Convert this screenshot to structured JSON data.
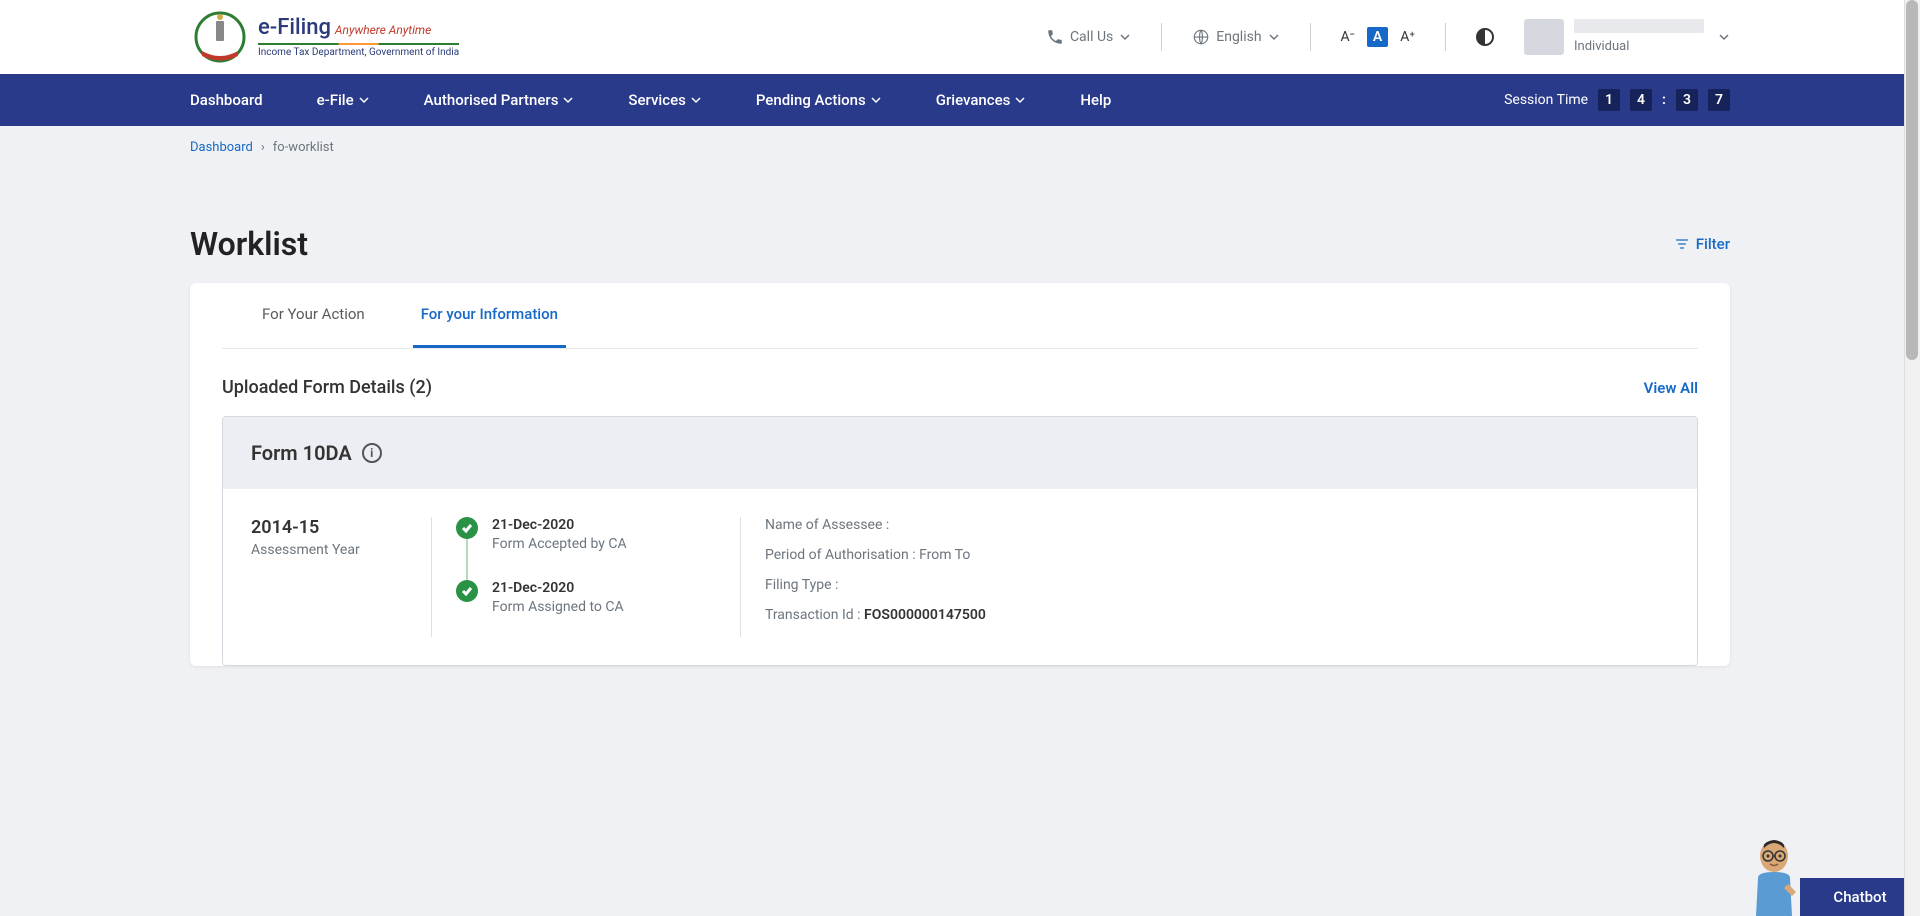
{
  "header": {
    "logo_main": "e-Filing",
    "logo_tagline": "Anywhere Anytime",
    "logo_sub": "Income Tax Department, Government of India",
    "call_us": "Call Us",
    "language": "English",
    "font_small": "A⁻",
    "font_normal": "A",
    "font_large": "A⁺",
    "user_type": "Individual"
  },
  "nav": {
    "items": [
      {
        "label": "Dashboard",
        "dropdown": false
      },
      {
        "label": "e-File",
        "dropdown": true
      },
      {
        "label": "Authorised Partners",
        "dropdown": true
      },
      {
        "label": "Services",
        "dropdown": true
      },
      {
        "label": "Pending Actions",
        "dropdown": true
      },
      {
        "label": "Grievances",
        "dropdown": true
      },
      {
        "label": "Help",
        "dropdown": false
      }
    ],
    "session_label": "Session Time",
    "session_digits": [
      "1",
      "4",
      "3",
      "7"
    ]
  },
  "breadcrumb": {
    "root": "Dashboard",
    "current": "fo-worklist"
  },
  "page": {
    "title": "Worklist",
    "filter": "Filter"
  },
  "tabs": {
    "action": "For Your Action",
    "info": "For your Information"
  },
  "section": {
    "title": "Uploaded Form Details (2)",
    "view_all": "View All"
  },
  "form": {
    "name": "Form 10DA",
    "ay_value": "2014-15",
    "ay_label": "Assessment Year",
    "timeline": [
      {
        "date": "21-Dec-2020",
        "label": "Form Accepted by CA"
      },
      {
        "date": "21-Dec-2020",
        "label": "Form Assigned to CA"
      }
    ],
    "details": {
      "assessee_label": "Name of Assessee :",
      "period_label": "Period of Authorisation : From To",
      "filing_label": "Filing Type :",
      "txn_label": "Transaction Id : ",
      "txn_value": "FOS000000147500"
    }
  },
  "chatbot": "Chatbot"
}
